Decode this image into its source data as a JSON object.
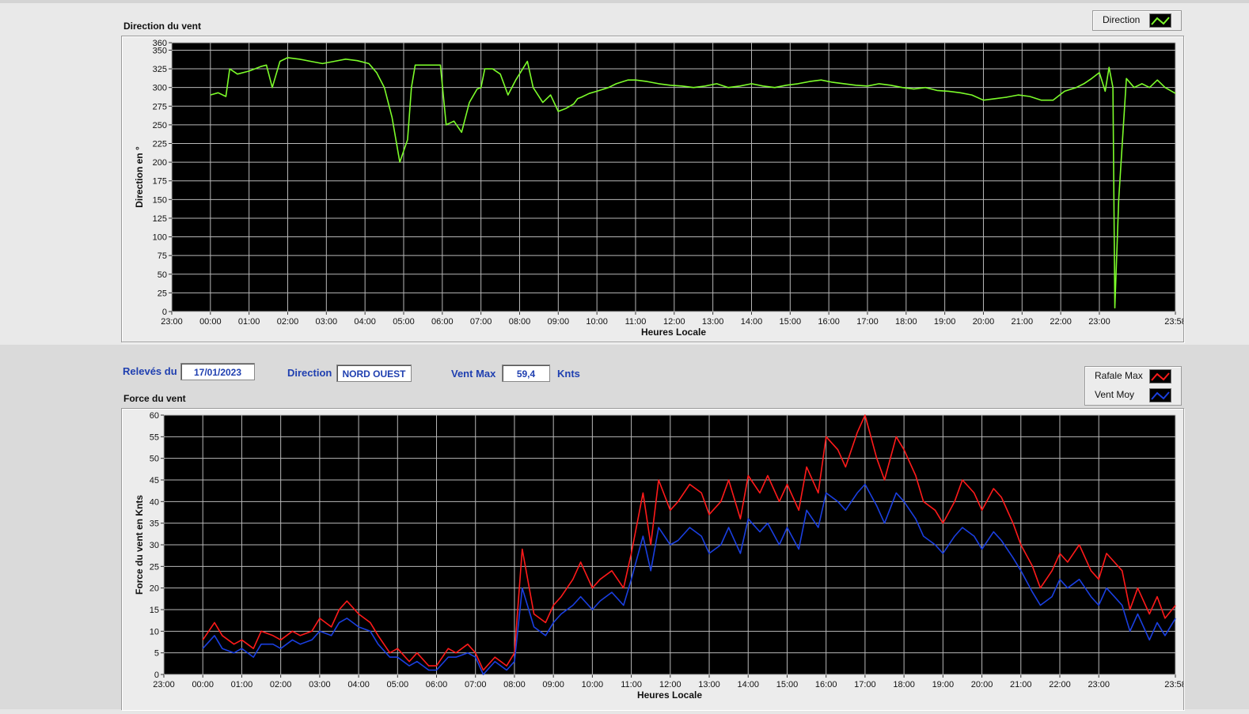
{
  "info": {
    "releves_label": "Relevés du",
    "date": "17/01/2023",
    "direction_label": "Direction",
    "direction_value": "NORD OUEST",
    "ventmax_label": "Vent Max",
    "ventmax_value": "59,4",
    "unit": "Knts"
  },
  "colors": {
    "direction": "#7cfc2a",
    "gust": "#ff1a1a",
    "mean": "#1a3fe0",
    "plot_bg": "#000000",
    "grid": "#b8b8b8"
  },
  "chart_data": [
    {
      "type": "line",
      "panel_title": "Direction du vent",
      "xlabel": "Heures Locale",
      "ylabel": "Direction en °",
      "ylim": [
        0,
        360
      ],
      "yticks": [
        "0",
        "25",
        "50",
        "75",
        "100",
        "125",
        "150",
        "175",
        "200",
        "225",
        "250",
        "275",
        "300",
        "325",
        "350",
        "360"
      ],
      "xticks": [
        "23:00",
        "00:00",
        "01:00",
        "02:00",
        "03:00",
        "04:00",
        "05:00",
        "06:00",
        "07:00",
        "08:00",
        "09:00",
        "10:00",
        "11:00",
        "12:00",
        "13:00",
        "14:00",
        "15:00",
        "16:00",
        "17:00",
        "18:00",
        "19:00",
        "20:00",
        "21:00",
        "22:00",
        "23:00",
        "23:58"
      ],
      "x_unit": "hours since 23:00",
      "grid": true,
      "legend": "top-right",
      "series": [
        {
          "name": "Direction",
          "x": [
            1.0,
            1.2,
            1.4,
            1.5,
            1.7,
            2.0,
            2.3,
            2.45,
            2.6,
            2.8,
            3.0,
            3.3,
            3.6,
            3.9,
            4.2,
            4.5,
            4.8,
            5.1,
            5.3,
            5.5,
            5.7,
            5.9,
            6.1,
            6.2,
            6.3,
            6.45,
            6.6,
            6.8,
            6.95,
            7.1,
            7.3,
            7.5,
            7.7,
            7.9,
            8.0,
            8.1,
            8.3,
            8.5,
            8.7,
            8.9,
            9.2,
            9.35,
            9.6,
            9.8,
            10.0,
            10.2,
            10.4,
            10.5,
            10.6,
            10.8,
            11.0,
            11.3,
            11.5,
            11.8,
            12.0,
            12.3,
            12.6,
            12.9,
            13.2,
            13.5,
            13.8,
            14.1,
            14.4,
            14.7,
            15.0,
            15.3,
            15.6,
            15.9,
            16.2,
            16.5,
            16.8,
            17.1,
            17.4,
            17.7,
            18.0,
            18.3,
            18.6,
            18.9,
            19.2,
            19.5,
            19.8,
            20.1,
            20.4,
            20.7,
            21.0,
            21.3,
            21.6,
            21.9,
            22.2,
            22.5,
            22.8,
            23.1,
            23.4,
            23.6,
            23.8,
            24.0,
            24.15,
            24.25,
            24.35,
            24.4,
            24.5,
            24.7,
            24.9,
            25.1,
            25.3,
            25.5,
            25.7,
            25.97
          ],
          "values": [
            290,
            293,
            288,
            325,
            318,
            322,
            328,
            330,
            300,
            335,
            340,
            338,
            335,
            332,
            335,
            338,
            336,
            332,
            320,
            300,
            260,
            200,
            230,
            300,
            330,
            330,
            330,
            330,
            330,
            250,
            255,
            240,
            280,
            298,
            300,
            325,
            325,
            318,
            290,
            310,
            335,
            300,
            280,
            290,
            268,
            272,
            278,
            285,
            287,
            292,
            295,
            300,
            305,
            310,
            310,
            308,
            305,
            303,
            302,
            300,
            302,
            305,
            300,
            302,
            305,
            302,
            300,
            303,
            305,
            308,
            310,
            307,
            305,
            303,
            302,
            305,
            303,
            300,
            298,
            300,
            296,
            295,
            293,
            290,
            283,
            285,
            287,
            290,
            288,
            283,
            283,
            295,
            300,
            305,
            312,
            320,
            295,
            327,
            300,
            5,
            150,
            312,
            300,
            305,
            300,
            310,
            300,
            292
          ]
        }
      ]
    },
    {
      "type": "line",
      "panel_title": "Force du vent",
      "xlabel": "Heures Locale",
      "ylabel": "Force du vent en Knts",
      "ylim": [
        0,
        60
      ],
      "yticks": [
        "0",
        "5",
        "10",
        "15",
        "20",
        "25",
        "30",
        "35",
        "40",
        "45",
        "50",
        "55",
        "60"
      ],
      "xticks": [
        "23:00",
        "00:00",
        "01:00",
        "02:00",
        "03:00",
        "04:00",
        "05:00",
        "06:00",
        "07:00",
        "08:00",
        "09:00",
        "10:00",
        "11:00",
        "12:00",
        "13:00",
        "14:00",
        "15:00",
        "16:00",
        "17:00",
        "18:00",
        "19:00",
        "20:00",
        "21:00",
        "22:00",
        "23:00",
        "23:58"
      ],
      "x_unit": "hours since 23:00",
      "grid": true,
      "legend": "top-right",
      "series": [
        {
          "name": "Rafale Max",
          "x": [
            1.0,
            1.3,
            1.5,
            1.8,
            2.0,
            2.3,
            2.5,
            2.8,
            3.0,
            3.3,
            3.5,
            3.8,
            4.0,
            4.3,
            4.5,
            4.7,
            5.0,
            5.3,
            5.5,
            5.8,
            6.0,
            6.3,
            6.5,
            6.8,
            7.0,
            7.3,
            7.5,
            7.8,
            8.0,
            8.2,
            8.5,
            8.8,
            9.0,
            9.2,
            9.5,
            9.8,
            10.0,
            10.2,
            10.5,
            10.7,
            11.0,
            11.2,
            11.5,
            11.8,
            12.0,
            12.3,
            12.5,
            12.7,
            13.0,
            13.2,
            13.5,
            13.8,
            14.0,
            14.3,
            14.5,
            14.8,
            15.0,
            15.3,
            15.5,
            15.8,
            16.0,
            16.3,
            16.5,
            16.8,
            17.0,
            17.3,
            17.5,
            17.8,
            18.0,
            18.3,
            18.5,
            18.8,
            19.0,
            19.3,
            19.5,
            19.8,
            20.0,
            20.3,
            20.5,
            20.8,
            21.0,
            21.3,
            21.5,
            21.8,
            22.0,
            22.3,
            22.5,
            22.8,
            23.0,
            23.2,
            23.5,
            23.8,
            24.0,
            24.2,
            24.4,
            24.6,
            24.8,
            25.0,
            25.3,
            25.5,
            25.7,
            25.97
          ],
          "values": [
            8,
            12,
            9,
            7,
            8,
            6,
            10,
            9,
            8,
            10,
            9,
            10,
            13,
            11,
            15,
            17,
            14,
            12,
            9,
            5,
            6,
            3,
            5,
            2,
            2,
            6,
            5,
            7,
            5,
            1,
            4,
            2,
            5,
            29,
            14,
            12,
            16,
            18,
            22,
            26,
            20,
            22,
            24,
            20,
            28,
            42,
            30,
            45,
            38,
            40,
            44,
            42,
            37,
            40,
            45,
            36,
            46,
            42,
            46,
            40,
            44,
            38,
            48,
            42,
            55,
            52,
            48,
            56,
            60,
            50,
            45,
            55,
            52,
            46,
            40,
            38,
            35,
            40,
            45,
            42,
            38,
            43,
            41,
            35,
            30,
            25,
            20,
            24,
            28,
            26,
            30,
            24,
            22,
            28,
            26,
            24,
            15,
            20,
            14,
            18,
            13,
            16
          ]
        },
        {
          "name": "Vent Moy",
          "x": [
            1.0,
            1.3,
            1.5,
            1.8,
            2.0,
            2.3,
            2.5,
            2.8,
            3.0,
            3.3,
            3.5,
            3.8,
            4.0,
            4.3,
            4.5,
            4.7,
            5.0,
            5.3,
            5.5,
            5.8,
            6.0,
            6.3,
            6.5,
            6.8,
            7.0,
            7.3,
            7.5,
            7.8,
            8.0,
            8.2,
            8.5,
            8.8,
            9.0,
            9.2,
            9.5,
            9.8,
            10.0,
            10.2,
            10.5,
            10.7,
            11.0,
            11.2,
            11.5,
            11.8,
            12.0,
            12.3,
            12.5,
            12.7,
            13.0,
            13.2,
            13.5,
            13.8,
            14.0,
            14.3,
            14.5,
            14.8,
            15.0,
            15.3,
            15.5,
            15.8,
            16.0,
            16.3,
            16.5,
            16.8,
            17.0,
            17.3,
            17.5,
            17.8,
            18.0,
            18.3,
            18.5,
            18.8,
            19.0,
            19.3,
            19.5,
            19.8,
            20.0,
            20.3,
            20.5,
            20.8,
            21.0,
            21.3,
            21.5,
            21.8,
            22.0,
            22.3,
            22.5,
            22.8,
            23.0,
            23.2,
            23.5,
            23.8,
            24.0,
            24.2,
            24.4,
            24.6,
            24.8,
            25.0,
            25.3,
            25.5,
            25.7,
            25.97
          ],
          "values": [
            6,
            9,
            6,
            5,
            6,
            4,
            7,
            7,
            6,
            8,
            7,
            8,
            10,
            9,
            12,
            13,
            11,
            10,
            7,
            4,
            4,
            2,
            3,
            1,
            1,
            4,
            4,
            5,
            4,
            0,
            3,
            1,
            3,
            20,
            11,
            9,
            12,
            14,
            16,
            18,
            15,
            17,
            19,
            16,
            22,
            32,
            24,
            34,
            30,
            31,
            34,
            32,
            28,
            30,
            34,
            28,
            36,
            33,
            35,
            30,
            34,
            29,
            38,
            34,
            42,
            40,
            38,
            42,
            44,
            39,
            35,
            42,
            40,
            36,
            32,
            30,
            28,
            32,
            34,
            32,
            29,
            33,
            31,
            27,
            24,
            19,
            16,
            18,
            22,
            20,
            22,
            18,
            16,
            20,
            18,
            16,
            10,
            14,
            8,
            12,
            9,
            13
          ]
        }
      ]
    }
  ]
}
